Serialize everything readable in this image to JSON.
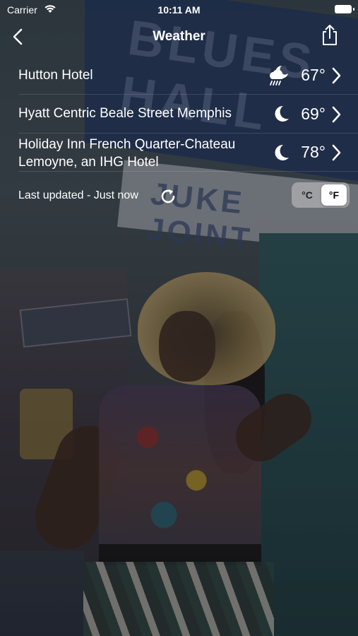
{
  "status_bar": {
    "carrier": "Carrier",
    "time": "10:11 AM"
  },
  "nav": {
    "title": "Weather"
  },
  "hotels": [
    {
      "name": "Hutton Hotel",
      "temp": "67°",
      "icon": "cloud-moon-rain-icon"
    },
    {
      "name": "Hyatt Centric Beale Street Memphis",
      "temp": "69°",
      "icon": "moon-icon"
    },
    {
      "name": "Holiday Inn French Quarter-Chateau Lemoyne, an IHG Hotel",
      "temp": "78°",
      "icon": "moon-icon"
    }
  ],
  "footer": {
    "last_updated": "Last updated - Just now"
  },
  "units": {
    "celsius": "°C",
    "fahrenheit": "°F",
    "selected": "fahrenheit"
  },
  "background": {
    "sign_text_1": "BLUES HALL",
    "sign_text_2": "JUKE JOINT"
  }
}
